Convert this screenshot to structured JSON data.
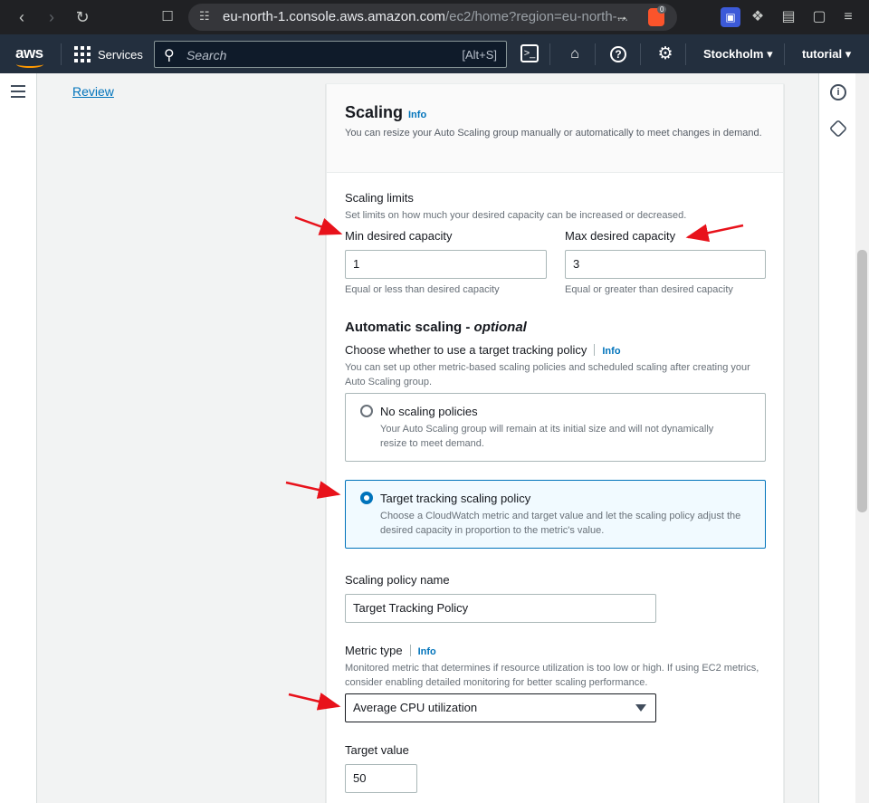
{
  "browser": {
    "url_host": "eu-north-1.console.aws.amazon.com",
    "url_path": "/ec2/home?region=eu-north-...",
    "shield_badge": "0"
  },
  "aws_nav": {
    "logo": "aws",
    "services_label": "Services",
    "search_placeholder": "Search",
    "search_shortcut": "[Alt+S]",
    "region": "Stockholm",
    "account": "tutorial"
  },
  "side_nav": {
    "review_link": "Review"
  },
  "scaling": {
    "title": "Scaling",
    "info": "Info",
    "description": "You can resize your Auto Scaling group manually or automatically to meet changes in demand.",
    "limits_label": "Scaling limits",
    "limits_desc": "Set limits on how much your desired capacity can be increased or decreased.",
    "min_label": "Min desired capacity",
    "min_value": "1",
    "min_hint": "Equal or less than desired capacity",
    "max_label": "Max desired capacity",
    "max_value": "3",
    "max_hint": "Equal or greater than desired capacity"
  },
  "auto_scaling": {
    "title_prefix": "Automatic scaling - ",
    "title_optional": "optional",
    "choose_label": "Choose whether to use a target tracking policy",
    "info": "Info",
    "choose_desc": "You can set up other metric-based scaling policies and scheduled scaling after creating your Auto Scaling group.",
    "options": [
      {
        "label": "No scaling policies",
        "desc": "Your Auto Scaling group will remain at its initial size and will not dynamically resize to meet demand.",
        "selected": false
      },
      {
        "label": "Target tracking scaling policy",
        "desc": "Choose a CloudWatch metric and target value and let the scaling policy adjust the desired capacity in proportion to the metric's value.",
        "selected": true
      }
    ],
    "policy_name_label": "Scaling policy name",
    "policy_name_value": "Target Tracking Policy",
    "metric_label": "Metric type",
    "metric_info": "Info",
    "metric_desc": "Monitored metric that determines if resource utilization is too low or high. If using EC2 metrics, consider enabling detailed monitoring for better scaling performance.",
    "metric_value": "Average CPU utilization",
    "target_label": "Target value",
    "target_value": "50"
  },
  "colors": {
    "aws_nav_bg": "#232f3e",
    "link": "#0073bb",
    "annotation_arrow": "#e8121b"
  }
}
